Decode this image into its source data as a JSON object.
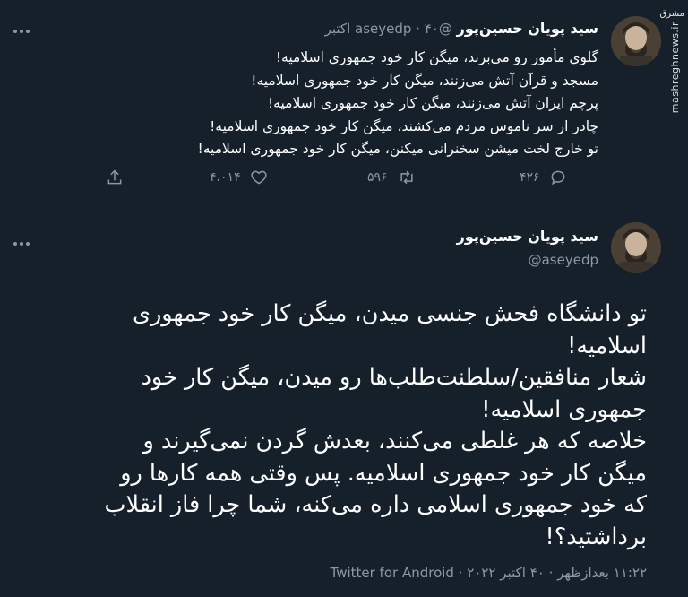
{
  "tweet1": {
    "display_name": "سید پویان حسین‌پور",
    "handle": "@aseyedp",
    "date": "۴۰ اکتبر",
    "separator": "·",
    "lines": [
      "گلوی مأمور رو می‌برند، میگن کار خود جمهوری اسلامیه!",
      "مسجد و قرآن آتش می‌زنند، میگن کار خود جمهوری اسلامیه!",
      "پرچم ایران آتش می‌زنند، میگن کار خود جمهوری اسلامیه!",
      "چادر از سر ناموس مردم می‌کشند، میگن کار خود جمهوری اسلامیه!",
      "تو خارج لخت میشن سخنرانی میکنن، میگن کار خود جمهوری اسلامیه!"
    ],
    "actions": {
      "reply_count": "۴۲۶",
      "retweet_count": "۵۹۶",
      "like_count": "۴،۰۱۴",
      "reply_icon": "reply-icon",
      "retweet_icon": "retweet-icon",
      "like_icon": "heart-icon",
      "share_icon": "share-icon"
    },
    "more_icon": "more-icon"
  },
  "tweet2": {
    "display_name": "سید پویان حسین‌پور",
    "handle": "@aseyedp",
    "lines": [
      "تو دانشگاه فحش جنسی میدن، میگن کار خود جمهوری",
      "اسلامیه!",
      "شعار منافقین/سلطنت‌طلب‌ها رو میدن، میگن کار خود",
      "جمهوری اسلامیه!",
      "خلاصه که هر غلطی می‌کنند، بعدش گردن نمی‌گیرند و",
      "میگن کار خود جمهوری اسلامیه. پس وقتی همه کارها رو",
      "که خود جمهوری اسلامی داره می‌کنه، شما چرا فاز انقلاب",
      "برداشتید؟!"
    ],
    "meta": "۱۱:۲۲ بعدازظهر · ۴۰ اکتبر ۲۰۲۲ · Twitter for Android",
    "more_icon": "more-icon"
  },
  "watermark": {
    "text": "mashreghnews.ir",
    "logo": "مشرق"
  },
  "colors": {
    "background": "#15202b",
    "text": "#ffffff",
    "secondary": "#8b98a5",
    "divider": "#38444d"
  }
}
